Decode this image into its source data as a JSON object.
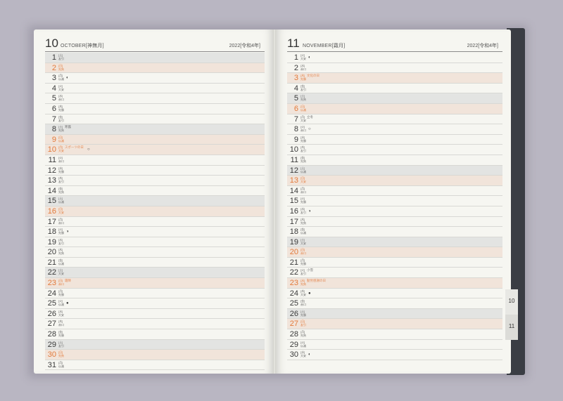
{
  "left": {
    "month_num": "10",
    "month_name": "OCTOBER[神無月]",
    "year": "2022[令和4年]",
    "days": [
      {
        "d": "1",
        "w": "[土]\n友引",
        "type": "band"
      },
      {
        "d": "2",
        "w": "[日]\n先負",
        "type": "holiday"
      },
      {
        "d": "3",
        "w": "[月]\n仏滅",
        "moon": "◐"
      },
      {
        "d": "4",
        "w": "[火]\n大安"
      },
      {
        "d": "5",
        "w": "[水]\n赤口"
      },
      {
        "d": "6",
        "w": "[木]\n先勝"
      },
      {
        "d": "7",
        "w": "[金]\n友引"
      },
      {
        "d": "8",
        "w": "[土]\n先負",
        "note": "寒露",
        "type": "band"
      },
      {
        "d": "9",
        "w": "[日]\n仏滅",
        "type": "holiday"
      },
      {
        "d": "10",
        "w": "[月]\n大安",
        "note": "スポーツの日",
        "moon": "○",
        "type": "holiday"
      },
      {
        "d": "11",
        "w": "[火]\n赤口"
      },
      {
        "d": "12",
        "w": "[水]\n先勝"
      },
      {
        "d": "13",
        "w": "[木]\n友引"
      },
      {
        "d": "14",
        "w": "[金]\n先負"
      },
      {
        "d": "15",
        "w": "[土]\n仏滅",
        "type": "band"
      },
      {
        "d": "16",
        "w": "[日]\n大安",
        "type": "holiday"
      },
      {
        "d": "17",
        "w": "[月]\n赤口"
      },
      {
        "d": "18",
        "w": "[火]\n先勝",
        "moon": "◑"
      },
      {
        "d": "19",
        "w": "[水]\n友引"
      },
      {
        "d": "20",
        "w": "[木]\n先負"
      },
      {
        "d": "21",
        "w": "[金]\n仏滅"
      },
      {
        "d": "22",
        "w": "[土]\n大安",
        "type": "band"
      },
      {
        "d": "23",
        "w": "[日]\n赤口",
        "note": "霜降",
        "type": "holiday"
      },
      {
        "d": "24",
        "w": "[月]\n先勝"
      },
      {
        "d": "25",
        "w": "[火]\n仏滅",
        "moon": "●"
      },
      {
        "d": "26",
        "w": "[水]\n大安"
      },
      {
        "d": "27",
        "w": "[木]\n赤口"
      },
      {
        "d": "28",
        "w": "[金]\n先勝"
      },
      {
        "d": "29",
        "w": "[土]\n友引",
        "type": "band"
      },
      {
        "d": "30",
        "w": "[日]\n先負",
        "type": "holiday"
      },
      {
        "d": "31",
        "w": "[月]\n仏滅"
      }
    ]
  },
  "right": {
    "month_num": "11",
    "month_name": "NOVEMBER[霜月]",
    "year": "2022[令和4年]",
    "days": [
      {
        "d": "1",
        "w": "[火]\n大安",
        "moon": "◐"
      },
      {
        "d": "2",
        "w": "[水]\n赤口"
      },
      {
        "d": "3",
        "w": "[木]\n先勝",
        "note": "文化の日",
        "type": "holiday"
      },
      {
        "d": "4",
        "w": "[金]\n友引"
      },
      {
        "d": "5",
        "w": "[土]\n先負",
        "type": "band"
      },
      {
        "d": "6",
        "w": "[日]\n仏滅",
        "type": "holiday"
      },
      {
        "d": "7",
        "w": "[月]\n大安",
        "note": "立冬"
      },
      {
        "d": "8",
        "w": "[火]\n赤口",
        "moon": "○"
      },
      {
        "d": "9",
        "w": "[水]\n先勝"
      },
      {
        "d": "10",
        "w": "[木]\n友引"
      },
      {
        "d": "11",
        "w": "[金]\n先負"
      },
      {
        "d": "12",
        "w": "[土]\n仏滅",
        "type": "band"
      },
      {
        "d": "13",
        "w": "[日]\n大安",
        "type": "holiday"
      },
      {
        "d": "14",
        "w": "[月]\n赤口"
      },
      {
        "d": "15",
        "w": "[火]\n先勝"
      },
      {
        "d": "16",
        "w": "[水]\n友引",
        "moon": "◑"
      },
      {
        "d": "17",
        "w": "[木]\n先負"
      },
      {
        "d": "18",
        "w": "[金]\n仏滅"
      },
      {
        "d": "19",
        "w": "[土]\n大安",
        "type": "band"
      },
      {
        "d": "20",
        "w": "[日]\n赤口",
        "type": "holiday"
      },
      {
        "d": "21",
        "w": "[月]\n先勝"
      },
      {
        "d": "22",
        "w": "[火]\n友引",
        "note": "小雪"
      },
      {
        "d": "23",
        "w": "[水]\n先負",
        "note": "勤労感謝の日",
        "type": "holiday"
      },
      {
        "d": "24",
        "w": "[木]\n大安",
        "moon": "●"
      },
      {
        "d": "25",
        "w": "[金]\n赤口"
      },
      {
        "d": "26",
        "w": "[土]\n先勝",
        "type": "band"
      },
      {
        "d": "27",
        "w": "[日]\n友引",
        "type": "holiday"
      },
      {
        "d": "28",
        "w": "[月]\n先負"
      },
      {
        "d": "29",
        "w": "[火]\n仏滅"
      },
      {
        "d": "30",
        "w": "[水]\n大安",
        "moon": "◐"
      }
    ]
  },
  "tabs": {
    "t10": "10",
    "t11": "11"
  }
}
